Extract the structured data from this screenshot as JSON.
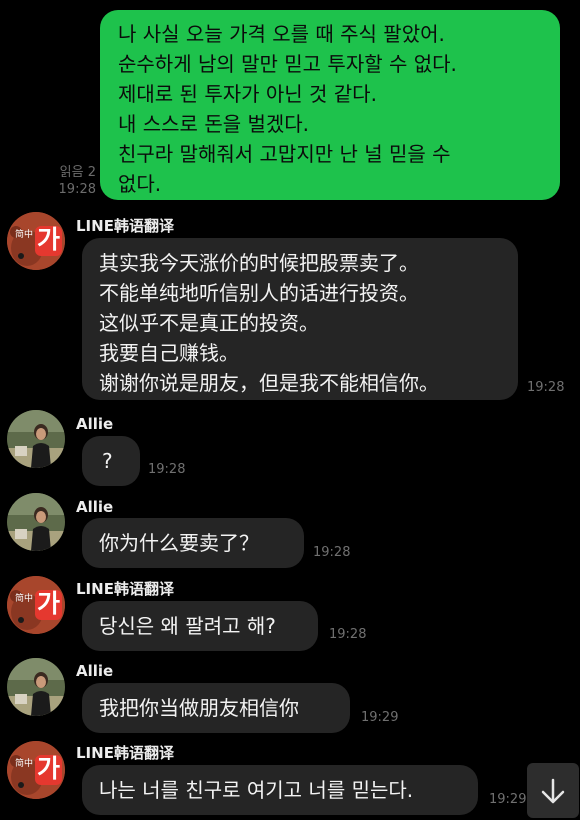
{
  "theme": {
    "background": "#000000",
    "outgoing_bubble": "#1ec24c",
    "incoming_bubble": "#252525",
    "translator_avatar": "#a8462c"
  },
  "outgoing": {
    "lines": [
      "나 사실 오늘 가격 오를 때 주식 팔았어.",
      "순수하게 남의 말만 믿고 투자할 수 없다.",
      "제대로 된 투자가 아닌 것 같다.",
      "내 스스로 돈을 벌겠다.",
      "친구라 말해줘서 고맙지만 난 널 믿을 수",
      "없다."
    ],
    "read_status": "읽음 2",
    "time": "19:28"
  },
  "messages": [
    {
      "sender": "LINE韩语翻译",
      "avatar": "translator-avatar",
      "avatar_badge_small": "简中",
      "avatar_badge_large": "가",
      "lines": [
        "其实我今天涨价的时候把股票卖了。",
        "不能单纯地听信别人的话进行投资。",
        "这似乎不是真正的投资。",
        "我要自己赚钱。",
        "谢谢你说是朋友，但是我不能相信你。"
      ],
      "time": "19:28"
    },
    {
      "sender": "Allie",
      "avatar": "allie-photo",
      "lines": [
        "?"
      ],
      "time": "19:28"
    },
    {
      "sender": "Allie",
      "avatar": "allie-photo",
      "lines": [
        "你为什么要卖了？"
      ],
      "time": "19:28"
    },
    {
      "sender": "LINE韩语翻译",
      "avatar": "translator-avatar",
      "avatar_badge_small": "简中",
      "avatar_badge_large": "가",
      "lines": [
        "당신은 왜 팔려고 해?"
      ],
      "time": "19:28"
    },
    {
      "sender": "Allie",
      "avatar": "allie-photo",
      "lines": [
        "我把你当做朋友相信你"
      ],
      "time": "19:29"
    },
    {
      "sender": "LINE韩语翻译",
      "avatar": "translator-avatar",
      "avatar_badge_small": "简中",
      "avatar_badge_large": "가",
      "lines": [
        "나는 너를 친구로 여기고 너를 믿는다."
      ],
      "time": "19:29"
    }
  ],
  "scroll_button": {
    "icon": "arrow-down-icon"
  }
}
